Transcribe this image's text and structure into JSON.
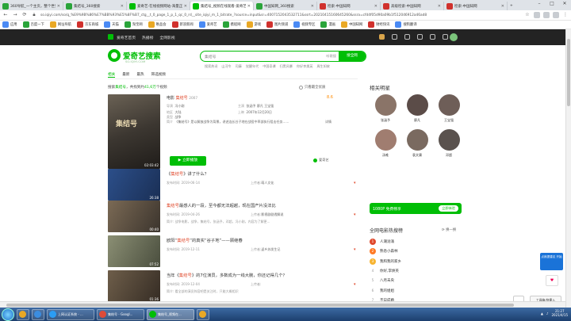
{
  "browser": {
    "tabs": [
      {
        "title": "360导航_一个主页，整个世界",
        "color": "#2aa43a",
        "active": false
      },
      {
        "title": "集结号_360搜索",
        "color": "#2aa43a",
        "active": false
      },
      {
        "title": "爱奇艺-在线视频网站-海量正版",
        "color": "#00be06",
        "active": false
      },
      {
        "title": "集结号_视频在线观看-爱奇艺",
        "color": "#00be06",
        "active": true
      },
      {
        "title": "中国知网_360搜索",
        "color": "#2aa43a",
        "active": false
      },
      {
        "title": "检索-中国知网",
        "color": "#d0312d",
        "active": false
      },
      {
        "title": "高级检索-中国知网",
        "color": "#d0312d",
        "active": false
      },
      {
        "title": "检索-中国知网",
        "color": "#d0312d",
        "active": false
      }
    ],
    "url": "so.iqiyi.com/so/q_%E9%9B%86%E7%BB%93%E5%8F%B7_ctg__t_0_page_1_p_1_qc_0_rd__site_iqiyi_m_1_bitrate_?source=input&sr=4007152043532711&ssrt=20210415160645260&ssra=cfd4f05d90a09b1f512046912a46ad8",
    "bookmarks": [
      "应用",
      "百度一下",
      "网址导航",
      "京东商城",
      "天猫",
      "淘宝网",
      "唯品会",
      "新浪新闻",
      "爱奇艺",
      "携程网",
      "游戏",
      "图片频道",
      "视频专区",
      "漫画",
      "中国知网",
      "财经快讯",
      "搜狗翻译"
    ]
  },
  "site": {
    "nav": [
      "爱奇艺首页",
      "热播榜",
      "全网影视"
    ],
    "brand": "爱奇艺搜索",
    "brand_sub": "SO.IQIYI.COM",
    "search_query": "集结号",
    "mic_label": "听歌搜",
    "search_button": "搜全网",
    "hotwords": [
      "搜索热词",
      "山河令",
      "司藤",
      "觉醒年代",
      "中国奇谭",
      "扫黑风暴",
      "你好李焕英",
      "周生如故"
    ],
    "filter_tabs": [
      "相关",
      "最新",
      "最热",
      "筛选视频"
    ],
    "result_info_prefix": "搜索",
    "result_query": "集结号",
    "result_info_mid": "，共找到约",
    "result_count": "41,6万",
    "result_info_suffix": "个视频",
    "only_full": "只看最全优质"
  },
  "first_result": {
    "kind": "电影",
    "title": "集结号",
    "year": "2007",
    "score": "8.6",
    "poster_caption": "集结号",
    "duration": "02:03:42",
    "director_label": "导演",
    "director": "冯小刚",
    "cast_label": "主演",
    "cast": "张涵予  廖凡  王宝强",
    "region_label": "地区",
    "region": "大陆",
    "release_label": "上映",
    "release": "2007年12月20日",
    "type_label": "类型",
    "type": "战争",
    "desc_label": "简介",
    "desc": "《集结号》是以解放战争为背景，讲述连长谷子地在战役中率部执行阻击任务……",
    "more": "详情",
    "play_button": "立即播放",
    "source": "爱奇艺"
  },
  "results": [
    {
      "prefix": "《",
      "kw": "集结号",
      "suffix": "》讲了什么？",
      "date": "发布时间: 2019-06-14",
      "uploader_label": "上传者:",
      "uploader": "萌人文化",
      "intro": "",
      "duration": "26:38"
    },
    {
      "prefix": "",
      "kw": "集结号",
      "suffix": "最感人的一段，至今都无法超越，现在国产片没法比",
      "date": "发布时间: 2019-04-26",
      "uploader_label": "上传者:",
      "uploader": "影视剧剧透解说",
      "intro": "简介: 战争电影，战争，集结号，张涵予，邓超，冯小刚，内容为了解更...",
      "duration": "00:40"
    },
    {
      "prefix": "欧阳“",
      "kw": "集结号",
      "suffix": "”的真实“谷子地”——顾继春",
      "date": "发布时间: 2019-12-11",
      "uploader_label": "上传者:",
      "uploader": "返乡苏发生记",
      "intro": "",
      "duration": "07:52"
    },
    {
      "prefix": "当年《",
      "kw": "集结号",
      "suffix": "》的7位演员，多数成为一线大腕，你还记得几个？",
      "date": "发布时间: 2019-12-04",
      "uploader_label": "上传者:",
      "uploader": "",
      "intro": "简介: 看全部的演员阵容吧是关注时，只能大概相识",
      "duration": "01:36"
    }
  ],
  "stars_title": "相关明星",
  "stars": [
    {
      "name": "张涵予",
      "color": "#8a7468"
    },
    {
      "name": "廖凡",
      "color": "#5b4c48"
    },
    {
      "name": "王宝强",
      "color": "#6e5e58"
    },
    {
      "name": "汤唯",
      "color": "#a07d70"
    },
    {
      "name": "袁文康",
      "color": "#7a6a60"
    },
    {
      "name": "邓超",
      "color": "#5a524e"
    }
  ],
  "promo": {
    "text": "1080P 免费畅享",
    "button": "立即体验"
  },
  "rank_title": "全网电影热搜榜",
  "rank_refresh": "换一换",
  "ranks": [
    {
      "n": "1",
      "title": "人潮汹涌",
      "hot": true,
      "trend": "",
      "color": "#e0492c"
    },
    {
      "n": "2",
      "title": "熟悉小森林",
      "hot": true,
      "trend": "",
      "color": "#ff7a26"
    },
    {
      "n": "3",
      "title": "我和我的家乡",
      "hot": true,
      "trend": "",
      "color": "#f7b431"
    },
    {
      "n": "4",
      "title": "你好,李焕英",
      "hot": false,
      "trend": "",
      "color": ""
    },
    {
      "n": "5",
      "title": "八月未央",
      "hot": false,
      "trend": "",
      "color": ""
    },
    {
      "n": "6",
      "title": "我的姐姐",
      "hot": false,
      "trend": "",
      "color": ""
    },
    {
      "n": "7",
      "title": "不日成婚",
      "hot": false,
      "trend": "",
      "color": ""
    },
    {
      "n": "8",
      "title": "我的警察父亲门",
      "hot": false,
      "trend": "",
      "color": ""
    },
    {
      "n": "9",
      "title": "温暖的抱抱",
      "hot": false,
      "trend": "↑",
      "color": ""
    },
    {
      "n": "10",
      "title": "怪物猎人",
      "hot": false,
      "trend": "",
      "color": ""
    }
  ],
  "widgets": {
    "tip": "点我提建议 开始",
    "float1": "♥",
    "float3": "工具箱/快捷入"
  },
  "taskbar": {
    "items": [
      {
        "label": "",
        "color": "#e9a825",
        "short": true
      },
      {
        "label": "",
        "color": "#3b8de0",
        "short": true
      },
      {
        "label": "上网认证系统 - ...",
        "color": "#2b9df4",
        "short": false
      },
      {
        "label": "集结号 - Googl...",
        "color": "#dd4b39",
        "short": false
      },
      {
        "label": "集结号_视频在...",
        "color": "#00be06",
        "short": false,
        "active": true
      },
      {
        "label": "",
        "color": "#e9a825",
        "short": true
      }
    ],
    "time": "21:27",
    "date": "2021/4/15"
  }
}
